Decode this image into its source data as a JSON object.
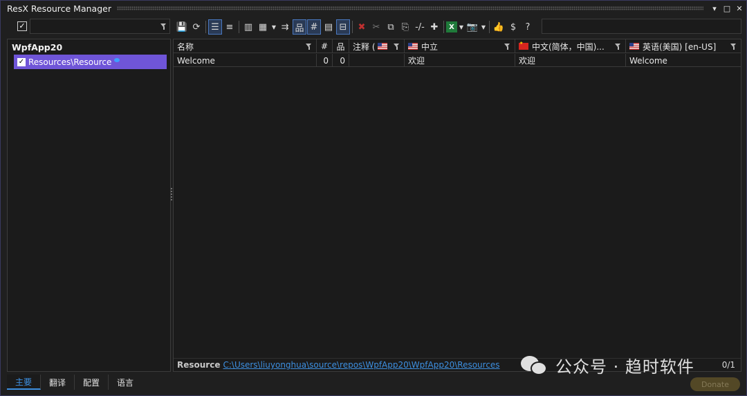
{
  "window": {
    "title": "ResX Resource Manager",
    "controls": [
      "▾",
      "□",
      "✕"
    ]
  },
  "toolbar": {
    "filter_placeholder": "",
    "icons": [
      "save-icon",
      "refresh-icon",
      "separator",
      "list-view-icon",
      "align-center-icon",
      "separator",
      "columns-icon",
      "columns-dropdown-icon",
      "chevron-down-icon",
      "import-icon",
      "tree-view-icon",
      "hash-icon",
      "grid-view-icon",
      "wrap-text-icon",
      "separator",
      "delete-icon",
      "cut-icon",
      "copy-icon",
      "paste-icon",
      "comment-icon",
      "add-icon",
      "separator",
      "excel-icon",
      "chevron-down-icon",
      "camera-icon",
      "chevron-down-icon",
      "separator",
      "thumbs-up-icon",
      "dollar-icon",
      "help-icon"
    ]
  },
  "tree": {
    "root": "WpfApp20",
    "items": [
      {
        "label": "Resources\\Resource",
        "checked": true
      }
    ]
  },
  "grid": {
    "columns": [
      {
        "label": "名称",
        "flag": ""
      },
      {
        "label": "#",
        "flag": ""
      },
      {
        "label": "品",
        "flag": ""
      },
      {
        "label": "注释 (",
        "flag": "us"
      },
      {
        "label": "中立",
        "flag": "us"
      },
      {
        "label": "中文(简体，中国)...",
        "flag": "cn"
      },
      {
        "label": "英语(美国) [en-US]",
        "flag": "us"
      }
    ],
    "rows": [
      [
        "Welcome",
        "0",
        "0",
        "",
        "欢迎",
        "欢迎",
        "Welcome"
      ]
    ]
  },
  "resource_bar": {
    "label": "Resource",
    "path": "C:\\Users\\liuyonghua\\source\\repos\\WpfApp20\\WpfApp20\\Resources",
    "count": "0/1"
  },
  "watermark": {
    "text": "公众号 · 趋时软件"
  },
  "bottom_tabs": [
    {
      "label": "主要",
      "active": true
    },
    {
      "label": "翻译",
      "active": false
    },
    {
      "label": "配置",
      "active": false
    },
    {
      "label": "语言",
      "active": false
    }
  ],
  "donate_label": "Donate",
  "colors": {
    "accent": "#3d8fe0",
    "selection": "#6f55d8",
    "background": "#1f1f1f"
  }
}
